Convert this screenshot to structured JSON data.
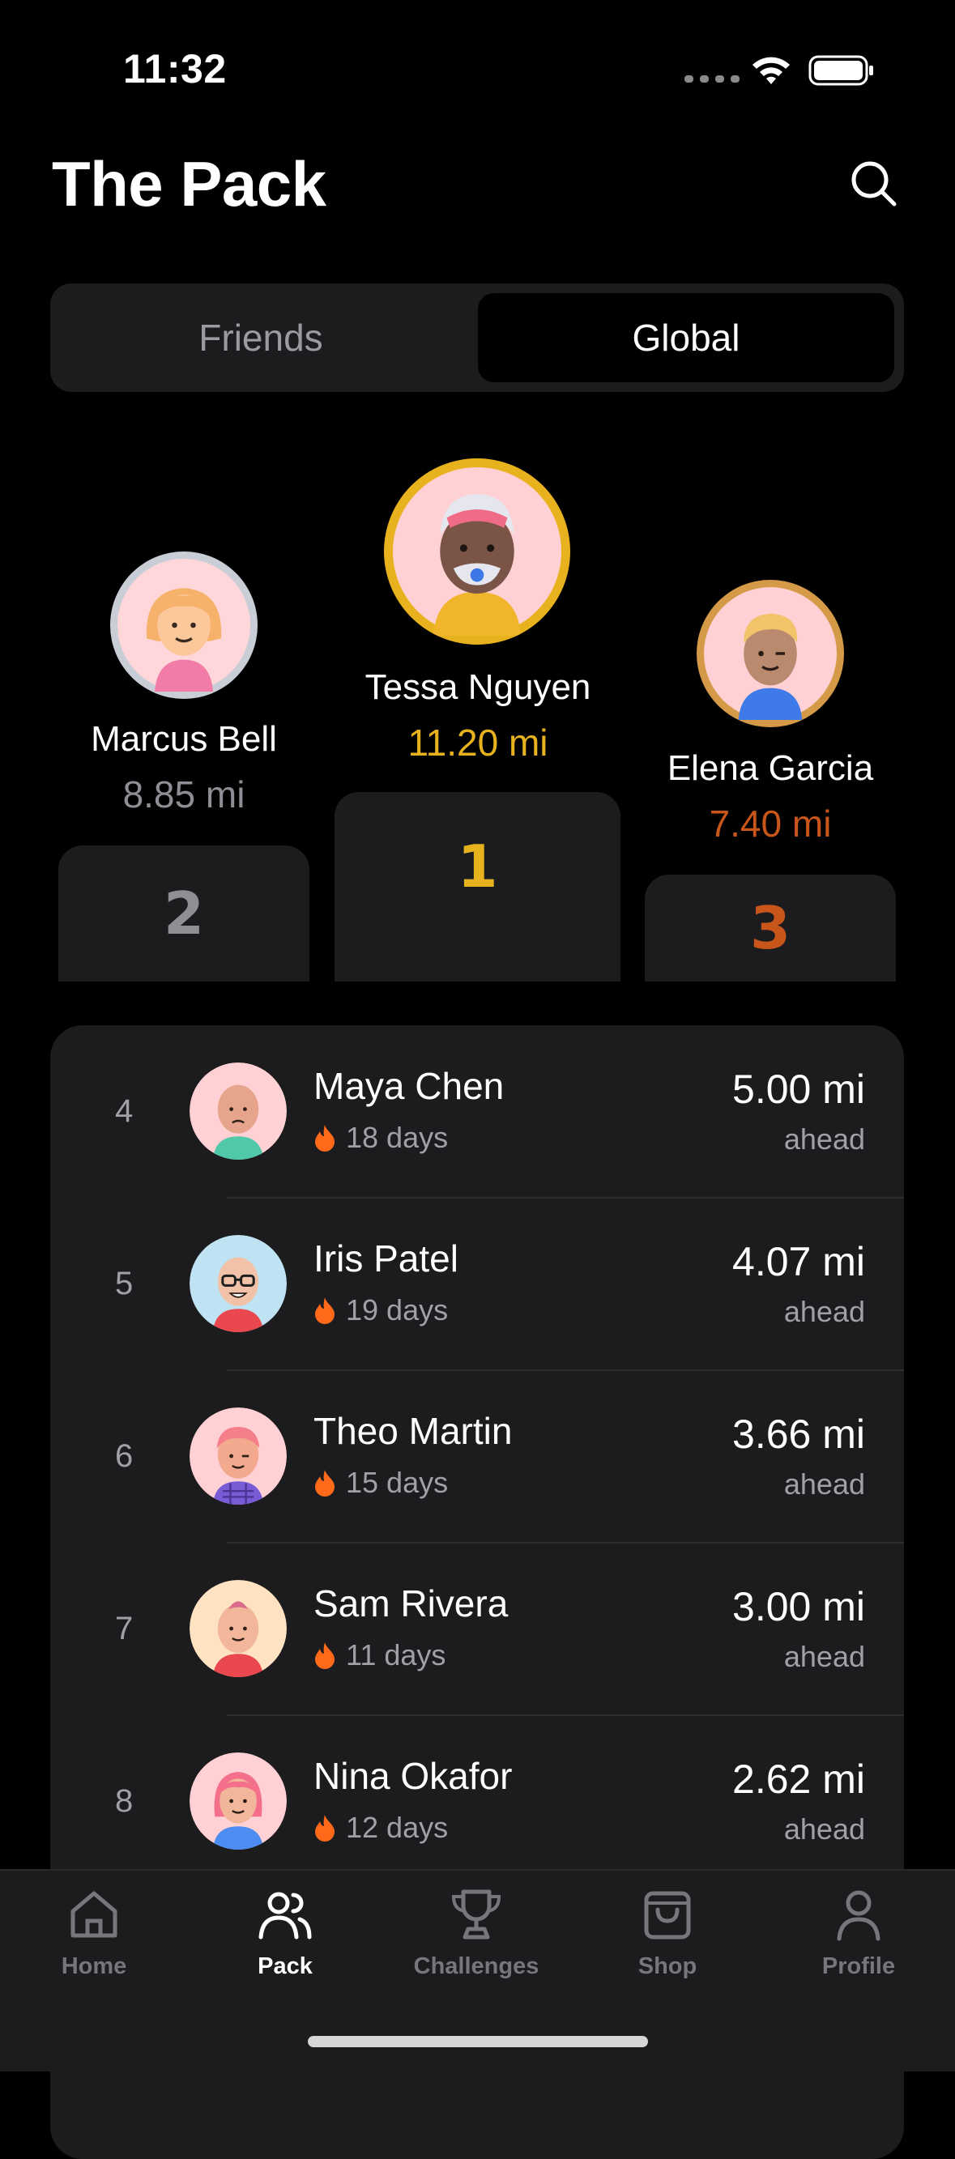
{
  "status_bar": {
    "time": "11:32"
  },
  "header": {
    "title": "The Pack"
  },
  "segments": {
    "friends": "Friends",
    "global": "Global",
    "selected": "Global"
  },
  "podium": {
    "first": {
      "rank": "1",
      "name": "Tessa Nguyen",
      "distance": "11.20 mi",
      "color": "#E8B21F"
    },
    "second": {
      "rank": "2",
      "name": "Marcus Bell",
      "distance": "8.85 mi",
      "color": "#8E8E94"
    },
    "third": {
      "rank": "3",
      "name": "Elena Garcia",
      "distance": "7.40 mi",
      "color": "#C8551A"
    }
  },
  "leaderboard": [
    {
      "rank": "4",
      "name": "Maya Chen",
      "streak": "18 days",
      "distance": "5.00 mi",
      "sub": "ahead"
    },
    {
      "rank": "5",
      "name": "Iris Patel",
      "streak": "19 days",
      "distance": "4.07 mi",
      "sub": "ahead"
    },
    {
      "rank": "6",
      "name": "Theo Martin",
      "streak": "15 days",
      "distance": "3.66 mi",
      "sub": "ahead"
    },
    {
      "rank": "7",
      "name": "Sam Rivera",
      "streak": "11 days",
      "distance": "3.00 mi",
      "sub": "ahead"
    },
    {
      "rank": "8",
      "name": "Nina Okafor",
      "streak": "12 days",
      "distance": "2.62 mi",
      "sub": "ahead"
    }
  ],
  "tabs": [
    {
      "label": "Home",
      "icon": "home-icon"
    },
    {
      "label": "Pack",
      "icon": "pack-icon",
      "active": true
    },
    {
      "label": "Challenges",
      "icon": "trophy-icon"
    },
    {
      "label": "Shop",
      "icon": "bag-icon"
    },
    {
      "label": "Profile",
      "icon": "person-icon"
    }
  ],
  "colors": {
    "accent_gold": "#E8B21F",
    "accent_silver": "#8E8E94",
    "accent_bronze": "#C8551A",
    "flame": "#FF6A1A"
  }
}
